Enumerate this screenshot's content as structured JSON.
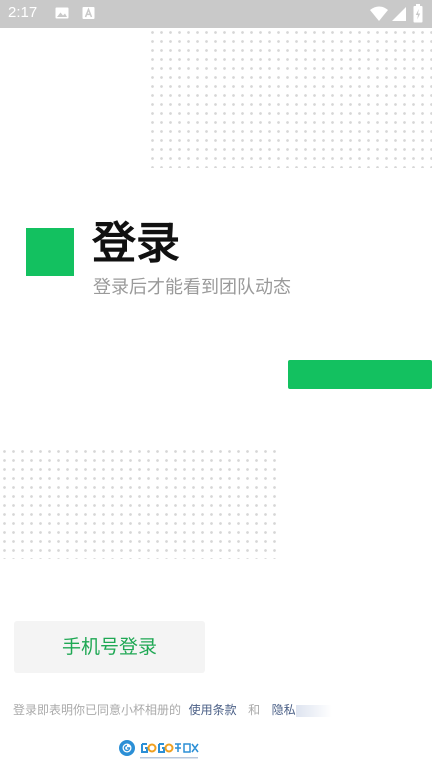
{
  "status_bar": {
    "time": "2:17",
    "icons": [
      "image-icon",
      "a-icon",
      "wifi-icon",
      "cellular-signal-icon",
      "battery-icon"
    ]
  },
  "header": {
    "title": "登录",
    "subtitle": "登录后才能看到团队动态"
  },
  "actions": {
    "phone_login_label": "手机号登录"
  },
  "agreement": {
    "prefix": "登录即表明你已同意小杯相册的",
    "terms_link": "使用条款",
    "conjunction": "和",
    "privacy_link": "隐私"
  },
  "watermark": {
    "brand": "GOGO手游网"
  },
  "colors": {
    "accent": "#13c160",
    "status_bar": "#c9c9c9",
    "link": "#4a5f86"
  }
}
